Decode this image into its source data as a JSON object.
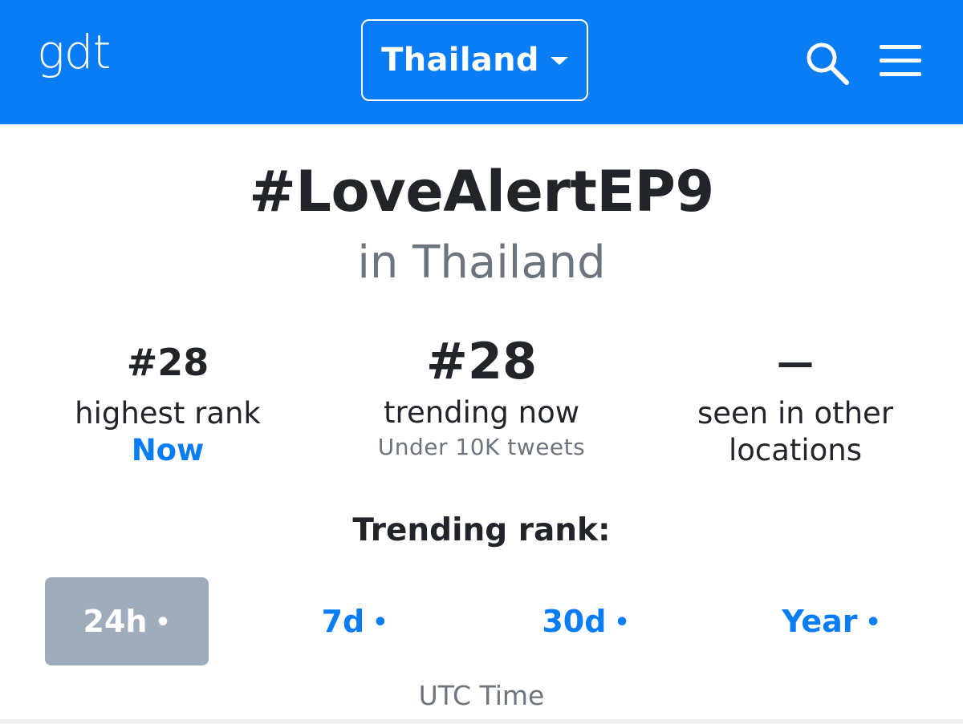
{
  "navbar": {
    "logo": "gdt",
    "country": "Thailand",
    "search_icon": "search-icon",
    "menu_icon": "hamburger-menu-icon",
    "background_color": "#0a7cf4"
  },
  "hashtag": {
    "title": "#LoveAlertEP9",
    "location": "in Thailand"
  },
  "stats": {
    "highest": {
      "value": "#28",
      "label": "highest rank",
      "when": "Now"
    },
    "current": {
      "value": "#28",
      "label": "trending now",
      "volume": "Under 10K tweets"
    },
    "other": {
      "value": "—",
      "label_line1": "seen in other",
      "label_line2": "locations"
    }
  },
  "rank_section": {
    "title": "Trending rank:",
    "tabs": [
      {
        "label": "24h",
        "dot": "•",
        "active": true
      },
      {
        "label": "7d",
        "dot": "•",
        "active": false
      },
      {
        "label": "30d",
        "dot": "•",
        "active": false
      },
      {
        "label": "Year",
        "dot": "•",
        "active": false
      }
    ],
    "axis_label": "UTC Time"
  },
  "colors": {
    "accent": "#0a7cf4",
    "active_tab_bg": "#9eacbb",
    "muted_text": "#6c757d"
  }
}
